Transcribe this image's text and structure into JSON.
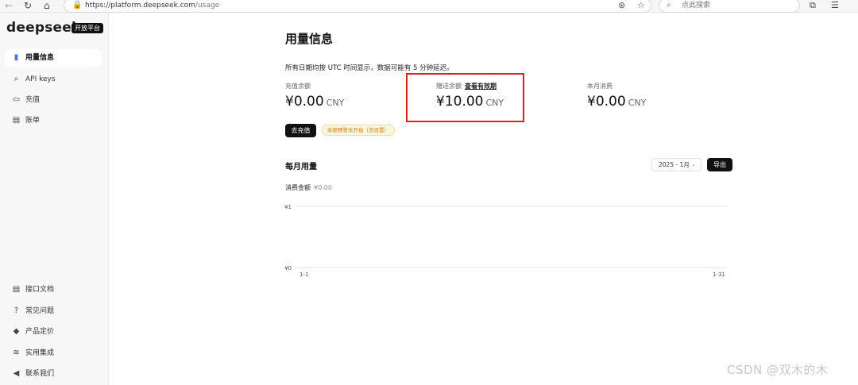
{
  "browser": {
    "url_host": "https://platform.deepseek.com",
    "url_path": "/usage",
    "search_placeholder": "点此搜索",
    "icons": [
      "back-icon",
      "refresh-icon",
      "home-icon",
      "lock-icon",
      "translate-icon",
      "star-icon",
      "search-icon",
      "extensions-icon",
      "favorites-icon"
    ]
  },
  "sidebar": {
    "logo": "deepseek",
    "badge": "开放平台",
    "items": [
      {
        "label": "用量信息",
        "icon": "bar-chart-icon",
        "active": true
      },
      {
        "label": "API keys",
        "icon": "search-icon",
        "active": false
      },
      {
        "label": "充值",
        "icon": "wallet-icon",
        "active": false
      },
      {
        "label": "账单",
        "icon": "bill-icon",
        "active": false
      }
    ],
    "bottom_items": [
      {
        "label": "接口文档",
        "icon": "document-icon"
      },
      {
        "label": "常见问题",
        "icon": "question-icon"
      },
      {
        "label": "产品定价",
        "icon": "tag-icon"
      },
      {
        "label": "实用集成",
        "icon": "stack-icon"
      },
      {
        "label": "联系我们",
        "icon": "send-icon"
      }
    ]
  },
  "main": {
    "title": "用量信息",
    "note": "所有日期均按 UTC 时间显示，数据可能有 5 分钟延迟。",
    "stats": [
      {
        "label": "充值余额",
        "value": "¥0.00",
        "unit": "CNY"
      },
      {
        "label": "赠送余额",
        "link": "查看有效期",
        "value": "¥10.00",
        "unit": "CNY"
      },
      {
        "label": "本月消费",
        "value": "¥0.00",
        "unit": "CNY"
      }
    ],
    "topup_button": "去充值",
    "warning": "余额预警未开启（去设置）",
    "section_title": "每月用量",
    "month_select": "2025 - 1月",
    "export_button": "导出",
    "spend_label": "消费金额",
    "spend_value": "¥0.00"
  },
  "chart_data": {
    "type": "line",
    "y_ticks": [
      "¥1",
      "¥0"
    ],
    "ylim": [
      0,
      1
    ],
    "x_ticks": [
      "1-1",
      "1-31"
    ],
    "series": []
  },
  "watermark": "CSDN @双木的木"
}
